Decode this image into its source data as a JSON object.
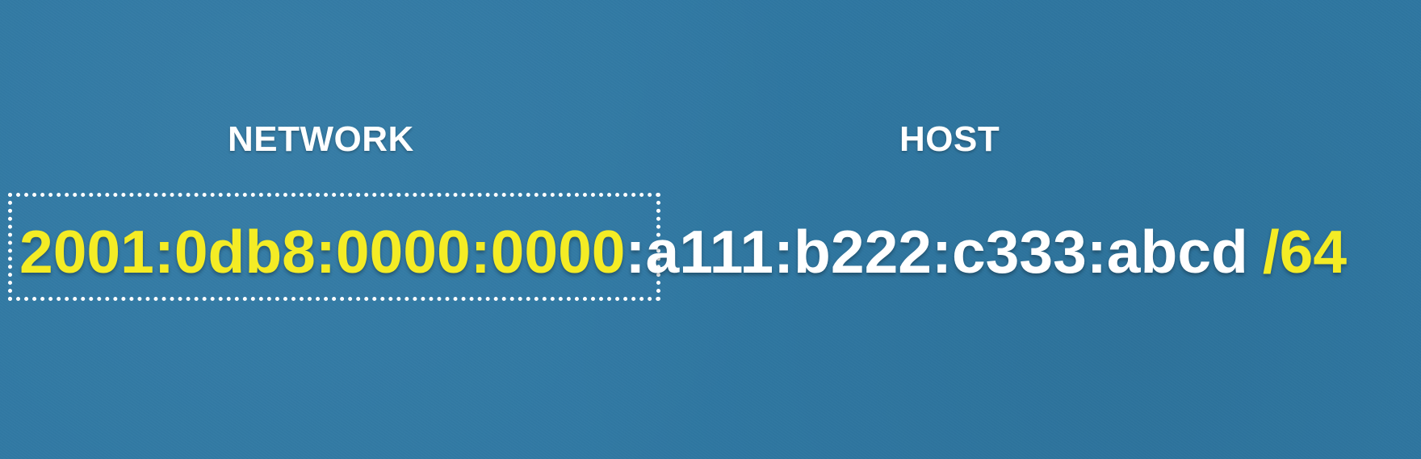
{
  "colors": {
    "background": "#2f78a3",
    "network_text": "#f4ec25",
    "host_text": "#ffffff",
    "box_border": "#ffffff"
  },
  "labels": {
    "network": "NETWORK",
    "host": "HOST"
  },
  "address": {
    "network_part": "2001:0db8:0000:0000",
    "separator": ":",
    "host_part": "a111:b222:c333:abcd",
    "prefix_length": "/64"
  }
}
